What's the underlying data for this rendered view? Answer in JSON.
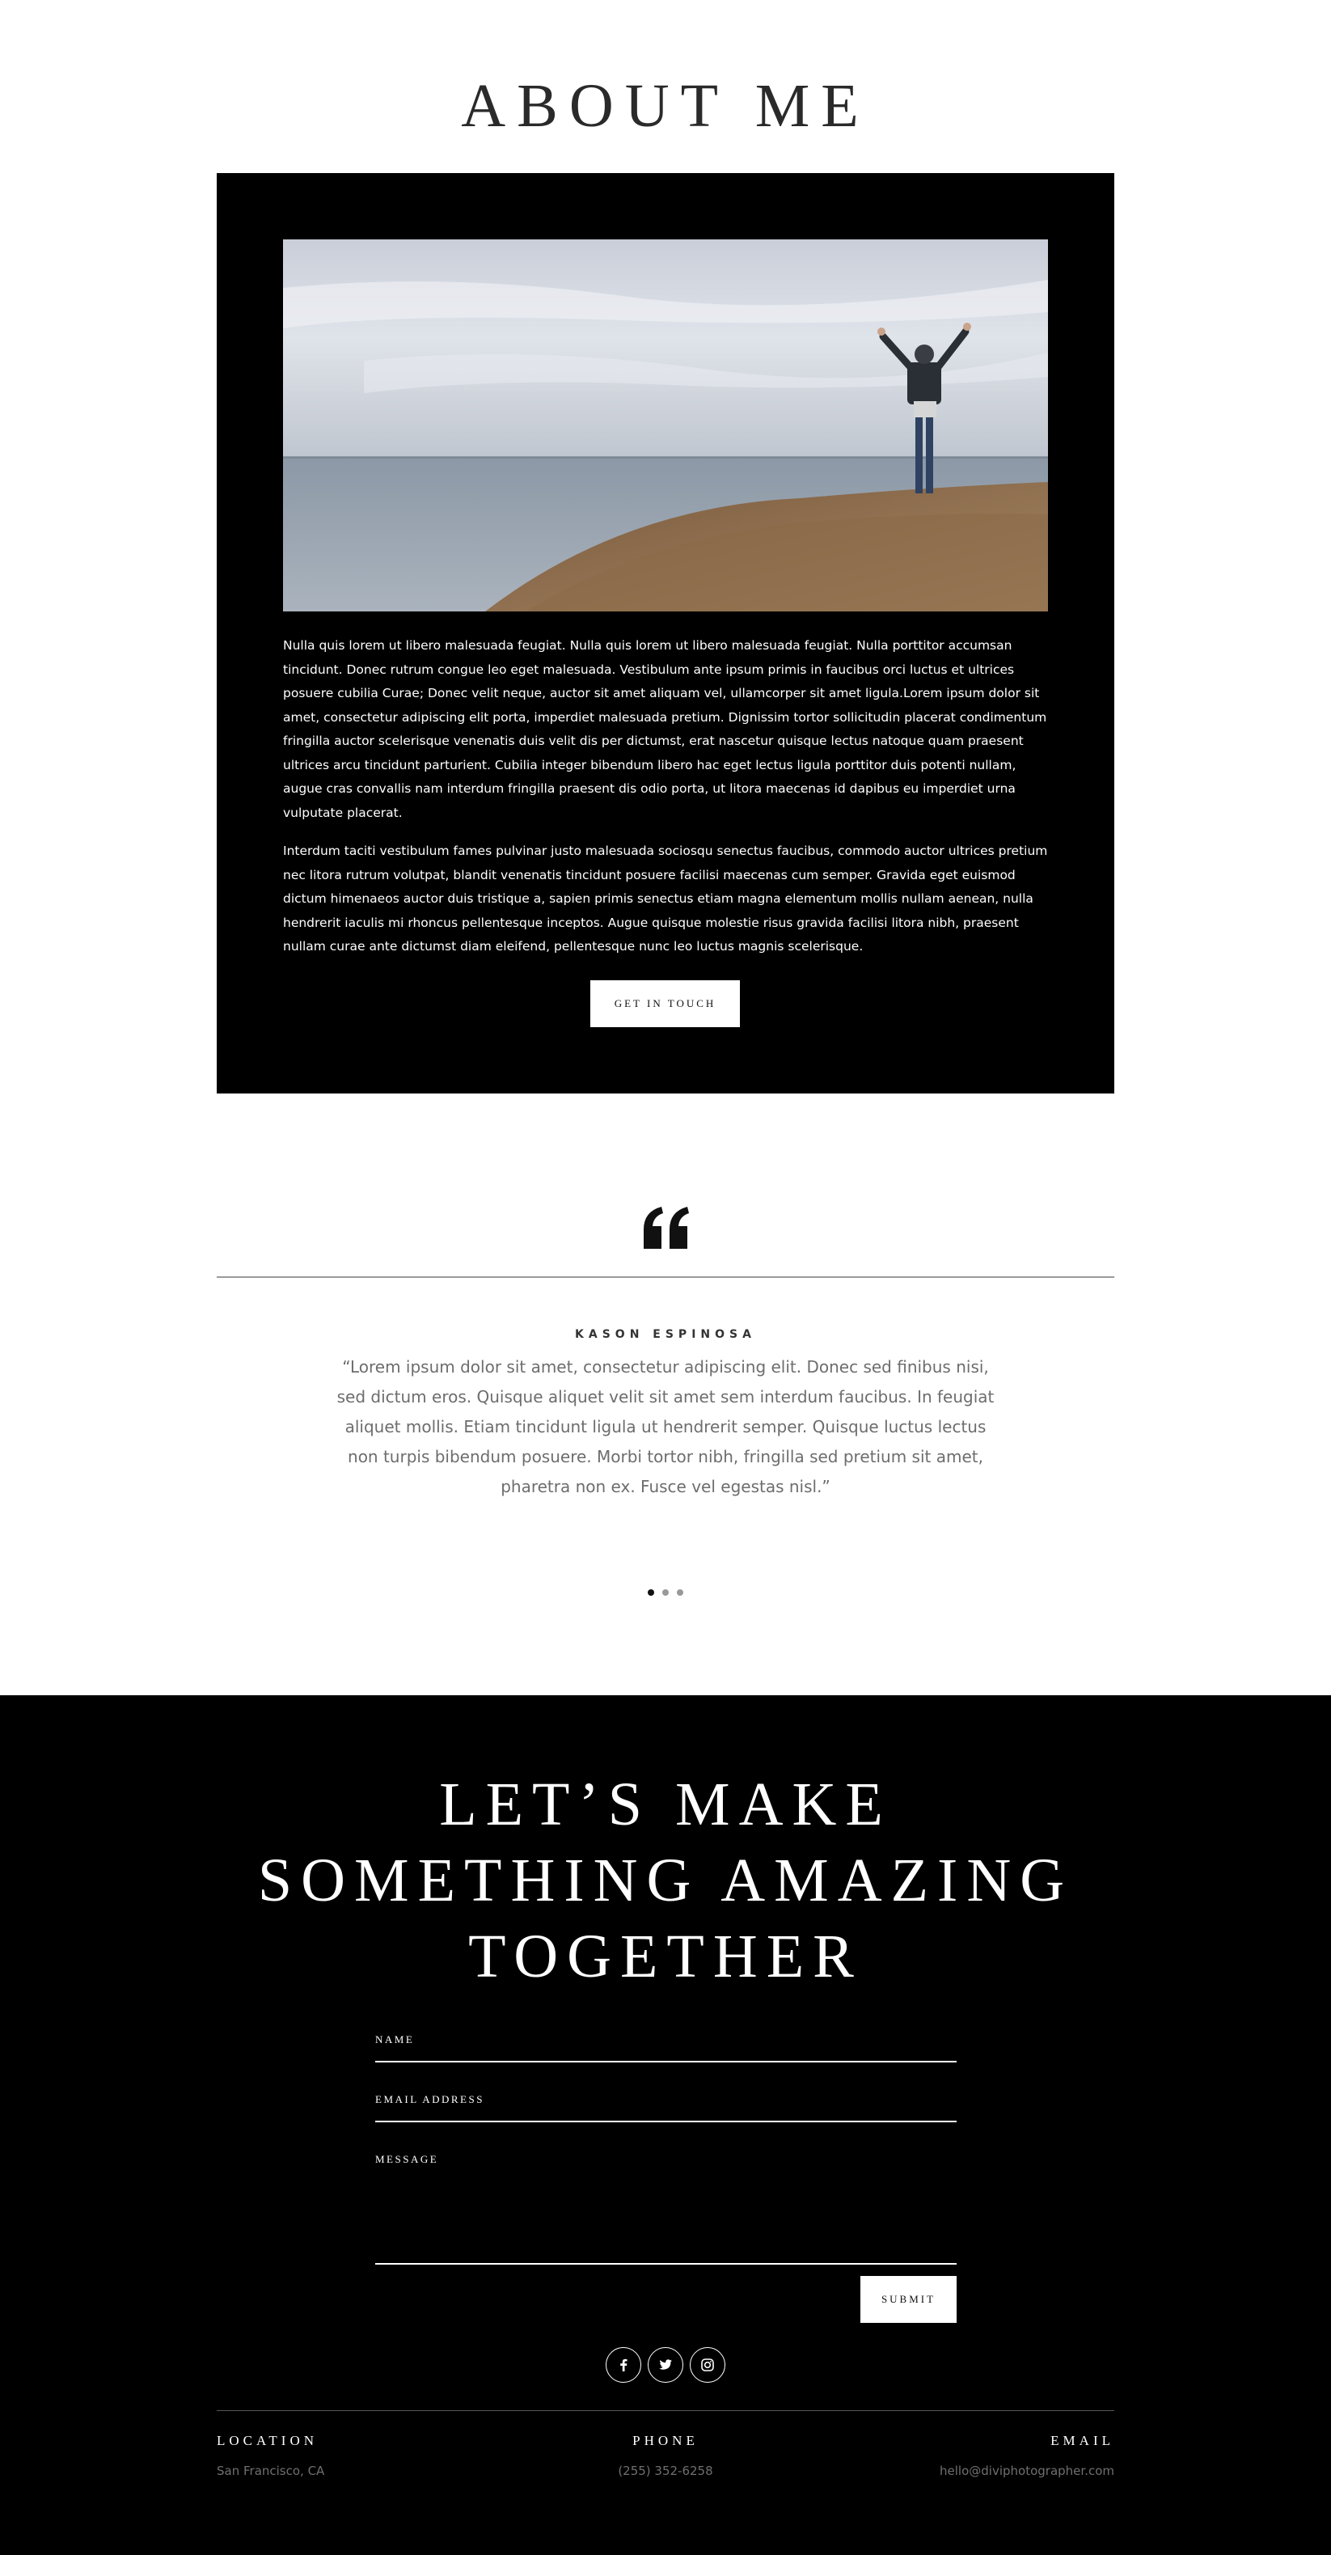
{
  "about": {
    "heading": "ABOUT ME",
    "paragraph_1": "Nulla quis lorem ut libero malesuada feugiat. Nulla quis lorem ut libero malesuada feugiat. Nulla porttitor accumsan tincidunt. Donec rutrum congue leo eget malesuada. Vestibulum ante ipsum primis in faucibus orci luctus et ultrices posuere cubilia Curae; Donec velit neque, auctor sit amet aliquam vel, ullamcorper sit amet ligula.Lorem ipsum dolor sit amet, consectetur adipiscing elit porta, imperdiet malesuada pretium. Dignissim tortor sollicitudin placerat condimentum fringilla auctor scelerisque venenatis duis velit dis per dictumst, erat nascetur quisque lectus natoque quam praesent ultrices arcu tincidunt parturient. Cubilia integer bibendum libero hac eget lectus ligula porttitor duis potenti nullam, augue cras convallis nam interdum fringilla praesent dis odio porta, ut litora maecenas id dapibus eu imperdiet urna vulputate placerat.",
    "paragraph_2": "Interdum taciti vestibulum fames pulvinar justo malesuada sociosqu senectus faucibus, commodo auctor ultrices pretium nec litora rutrum volutpat, blandit venenatis tincidunt posuere facilisi maecenas cum semper. Gravida eget euismod dictum himenaeos auctor duis tristique a, sapien primis senectus etiam magna elementum mollis nullam aenean, nulla hendrerit iaculis mi rhoncus pellentesque inceptos. Augue quisque molestie risus gravida facilisi litora nibh, praesent nullam curae ante dictumst diam eleifend, pellentesque nunc leo luctus magnis scelerisque.",
    "button_label": "GET IN TOUCH"
  },
  "testimonial": {
    "icon": "quote-icon",
    "author": "KASON ESPINOSA",
    "quote": "“Lorem ipsum dolor sit amet, consectetur adipiscing elit. Donec sed finibus nisi, sed dictum eros. Quisque aliquet velit sit amet sem interdum faucibus. In feugiat aliquet mollis. Etiam tincidunt ligula ut hendrerit semper. Quisque luctus lectus non turpis bibendum posuere. Morbi tortor nibh, fringilla sed pretium sit amet, pharetra non ex. Fusce vel egestas nisl.”",
    "slides": 3,
    "active_slide": 1
  },
  "contact": {
    "heading_line_1": "LET’S MAKE",
    "heading_line_2": "SOMETHING AMAZING",
    "heading_line_3": "TOGETHER",
    "name_label": "NAME",
    "email_label": "EMAIL ADDRESS",
    "message_label": "MESSAGE",
    "submit_label": "SUBMIT",
    "socials": [
      "facebook-icon",
      "twitter-icon",
      "instagram-icon"
    ]
  },
  "footer": {
    "location_title": "LOCATION",
    "location_value": "San Francisco, CA",
    "phone_title": "PHONE",
    "phone_value": "(255) 352-6258",
    "email_title": "EMAIL",
    "email_value": "hello@diviphotographer.com"
  },
  "colors": {
    "background": "#ffffff",
    "dark_section": "#000000",
    "heading_text": "#2a2a2a",
    "muted_text": "#6d6d6d"
  }
}
